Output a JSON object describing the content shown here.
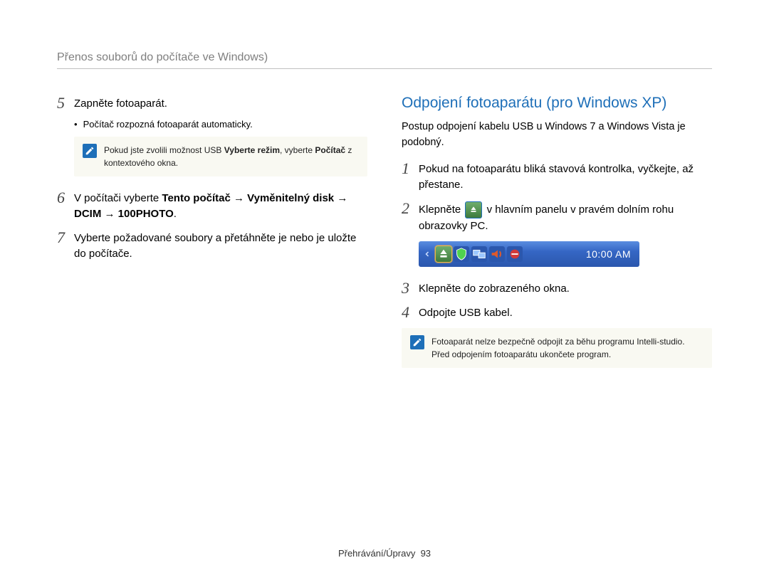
{
  "header": {
    "title": "Přenos souborů do počítače ve Windows)"
  },
  "left": {
    "step5": {
      "text": "Zapněte fotoaparát."
    },
    "bullet5": "Počítač rozpozná fotoaparát automaticky.",
    "note5_pre": "Pokud jste zvolili možnost USB ",
    "note5_bold1": "Vyberte režim",
    "note5_mid": ", vyberte ",
    "note5_bold2": "Počítač",
    "note5_post": " z kontextového okna.",
    "step6_pre": "V počítači vyberte ",
    "step6_b1": "Tento počítač",
    "step6_arr": " → ",
    "step6_b2": "Vyměnitelný disk",
    "step6_b3": "DCIM",
    "step6_b4": "100PHOTO",
    "step6_dot": ".",
    "step7": "Vyberte požadované soubory a přetáhněte je nebo je uložte do počítače."
  },
  "right": {
    "title": "Odpojení fotoaparátu (pro Windows XP)",
    "intro": "Postup odpojení kabelu USB u Windows 7 a Windows Vista je podobný.",
    "step1": "Pokud na fotoaparátu bliká stavová kontrolka, vyčkejte, až přestane.",
    "step2_pre": "Klepněte ",
    "step2_post": " v hlavním panelu v pravém dolním rohu obrazovky PC.",
    "step3": "Klepněte do zobrazeného okna.",
    "step4": "Odpojte USB kabel.",
    "note": "Fotoaparát nelze bezpečně odpojit za běhu programu Intelli-studio. Před odpojením fotoaparátu ukončete program.",
    "taskbar": {
      "clock": "10:00 AM"
    }
  },
  "footer": {
    "section": "Přehrávání/Úpravy",
    "page": "93"
  }
}
